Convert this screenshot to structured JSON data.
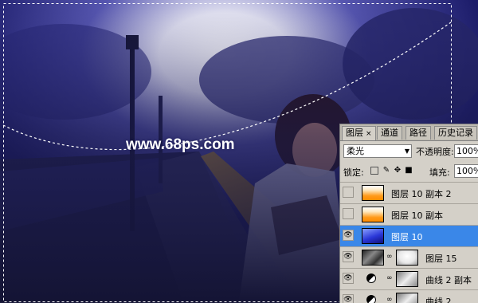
{
  "watermark": "www.68ps.com",
  "layers_panel": {
    "tabs": [
      {
        "label": "图层",
        "active": true,
        "close": "×"
      },
      {
        "label": "通道",
        "active": false
      },
      {
        "label": "路径",
        "active": false
      },
      {
        "label": "历史记录",
        "active": false
      }
    ],
    "blend_mode": "柔光",
    "opacity_label": "不透明度:",
    "opacity_value": "100%",
    "lock_label": "锁定:",
    "fill_label": "填充:",
    "fill_value": "100%",
    "layers": [
      {
        "name": "图层 10 副本 2",
        "visible": false,
        "thumb": "orange",
        "selected": false
      },
      {
        "name": "图层 10 副本",
        "visible": false,
        "thumb": "orange",
        "selected": false
      },
      {
        "name": "图层 10",
        "visible": true,
        "thumb": "blue",
        "selected": true
      },
      {
        "name": "图层 15",
        "visible": true,
        "thumb": "photo-mask",
        "selected": false
      },
      {
        "name": "曲线 2 副本",
        "visible": true,
        "thumb": "curves",
        "selected": false
      },
      {
        "name": "曲线 2",
        "visible": true,
        "thumb": "curves",
        "selected": false
      }
    ],
    "eye_glyph": "👁",
    "colors": {
      "panel_bg": "#d4d0c8",
      "selected_bg": "#3a87e8"
    }
  }
}
